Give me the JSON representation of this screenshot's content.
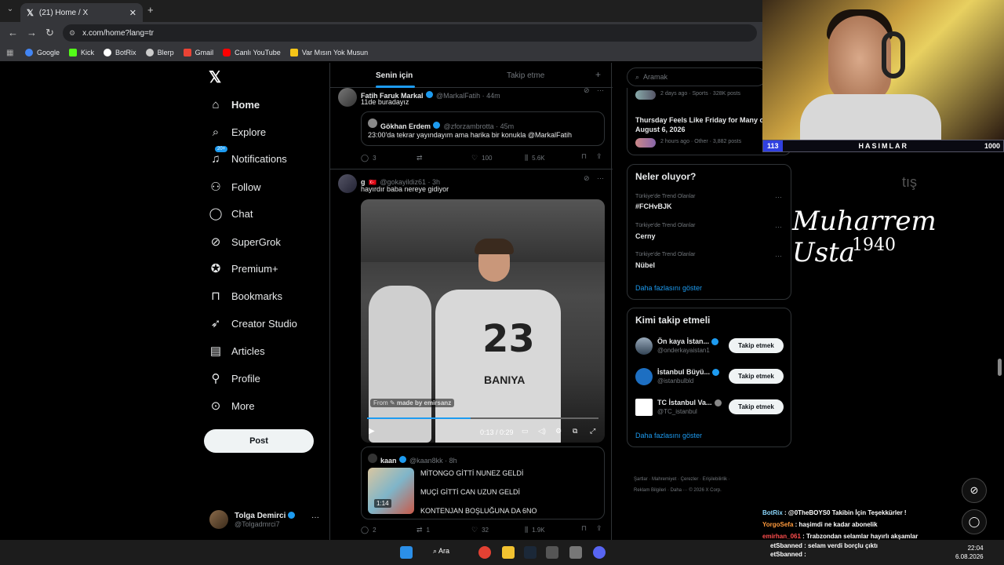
{
  "browser": {
    "tab_title": "(21) Home / X",
    "url": "x.com/home?lang=tr",
    "bookmarks": [
      {
        "label": "Google",
        "color": "#4285f4"
      },
      {
        "label": "Kick",
        "color": "#53fc18"
      },
      {
        "label": "BotRix",
        "color": "#ffffff"
      },
      {
        "label": "Blerp",
        "color": "#cccccc"
      },
      {
        "label": "Gmail",
        "color": "#ea4335"
      },
      {
        "label": "Canlı YouTube",
        "color": "#ff0000"
      },
      {
        "label": "Var Mısın Yok Musun",
        "color": "#f5c518"
      }
    ]
  },
  "nav": {
    "items": [
      {
        "label": "Home",
        "icon": "home-icon"
      },
      {
        "label": "Explore",
        "icon": "search-icon"
      },
      {
        "label": "Notifications",
        "icon": "bell-icon",
        "badge": "20+"
      },
      {
        "label": "Follow",
        "icon": "person-plus-icon"
      },
      {
        "label": "Chat",
        "icon": "chat-bubble-icon"
      },
      {
        "label": "SuperGrok",
        "icon": "grok-icon"
      },
      {
        "label": "Premium+",
        "icon": "premium-icon"
      },
      {
        "label": "Bookmarks",
        "icon": "bookmark-icon"
      },
      {
        "label": "Creator Studio",
        "icon": "rocket-icon"
      },
      {
        "label": "Articles",
        "icon": "article-icon"
      },
      {
        "label": "Profile",
        "icon": "person-icon"
      },
      {
        "label": "More",
        "icon": "more-circle-icon"
      }
    ],
    "post_label": "Post",
    "profile_name": "Tolga Demirci",
    "profile_handle": "@Tolgadmrci7",
    "profile_more": "···"
  },
  "feed": {
    "tab_for_you": "Senin için",
    "tab_following": "Takip etme",
    "tab_plus": "+",
    "tweet1": {
      "name": "Fatih Faruk Markal",
      "meta": "@MarkalFatih · 44m",
      "text": "11de buradayız",
      "quote_name": "Gökhan Erdem",
      "quote_meta": "@zforzambrotta · 45m",
      "quote_text": "23:00'da tekrar yayındayım ama harika bir konukla @MarkalFatih",
      "replies": "3",
      "likes": "100",
      "views": "5.6K"
    },
    "tweet2": {
      "name": "g",
      "meta": "@gokayildiz61 · 3h",
      "text": "hayırdır baba nereye gidiyor",
      "video_credit_from": "From",
      "video_credit": "made by emirsanz",
      "video_time": "0:13 / 0:29",
      "jersey_number": "23",
      "jersey_name": "BANIYA",
      "quote_name": "kaan",
      "quote_meta": "@kaan8kk · 8h",
      "quote_lines": [
        "MİTONGO GİTTİ NUNEZ GELDİ",
        "MUÇİ GİTTİ CAN UZUN GELDİ",
        "KONTENJAN BOŞLUĞUNA DA 6NO"
      ],
      "quote_thumb_time": "1:14",
      "replies": "2",
      "retweets": "1",
      "likes": "32",
      "views": "1.9K"
    }
  },
  "right": {
    "search_placeholder": "Aramak",
    "news1_meta": "2 days ago · Sports · 328K posts",
    "news2_title": "Thursday Feels Like Friday for Many o",
    "news2_date": "August 6, 2026",
    "news2_meta": "2 hours ago · Other · 3,882 posts",
    "whats_happening": "Neler oluyor?",
    "trends": [
      {
        "sub": "Türkiye'de Trend Olanlar",
        "name": "#FCHvBJK"
      },
      {
        "sub": "Türkiye'de Trend Olanlar",
        "name": "Cerny"
      },
      {
        "sub": "Türkiye'de Trend Olanlar",
        "name": "Nübel"
      }
    ],
    "show_more": "Daha fazlasını göster",
    "who_to_follow": "Kimi takip etmeli",
    "follows": [
      {
        "name": "Ön kaya İstan...",
        "handle": "@onderkayaistan1"
      },
      {
        "name": "İstanbul Büyü...",
        "handle": "@istanbulbld"
      },
      {
        "name": "TC İstanbul Va...",
        "handle": "@TC_istanbul"
      }
    ],
    "follow_btn": "Takip etmek",
    "show_more2": "Daha fazlasını göster",
    "footer1": "Şartlar  ·  Mahremiyet  ·  Çerezler  ·  Erişilebilirlik  ·",
    "footer2": "Reklam Bilgileri  ·  Daha ···  © 2026 X Corp."
  },
  "stream": {
    "bar_left": "113",
    "bar_mid": "HASIMLAR",
    "bar_right": "1000",
    "signature": "Muharrem Usta",
    "year": "1940",
    "faint": "tış",
    "chat": [
      {
        "user": "BotRix",
        "msg": ": @0TheBOYS0 Takibin İçin Teşekkürler !",
        "color": "#8cd9ff"
      },
      {
        "user": "YorgoSefa",
        "msg": ": haşimdi ne kadar abonelik",
        "color": "#ff9a3c"
      },
      {
        "user": "emirhan_061",
        "msg": ": Trabzondan selamlar hayırlı akşamlar",
        "color": "#ff4d4d"
      },
      {
        "user": "etSbanned",
        "msg": ": selam verdi borçlu çıktı",
        "color": "#ffffff"
      },
      {
        "user": "etSbanned",
        "msg": ":",
        "color": "#ffffff"
      }
    ]
  },
  "taskbar": {
    "search": "Ara",
    "time": "22:04",
    "date": "6.08.2026"
  }
}
